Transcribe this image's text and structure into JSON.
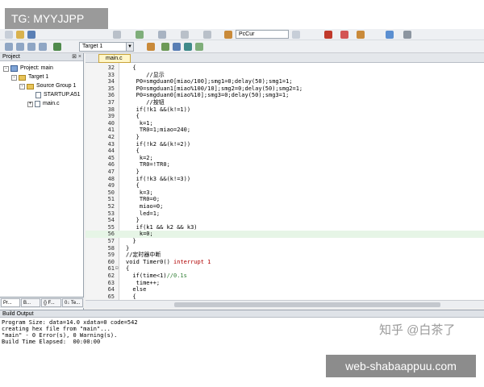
{
  "overlay": {
    "tag": "TG: MYYJJPP",
    "watermark": "知乎 @白茶了",
    "site": "web-shabaappuu.com"
  },
  "toolbar": {
    "target_select": "Target 1",
    "pc_combo": "PcCur"
  },
  "project_panel": {
    "title": "Project",
    "pin": "⊠ ×",
    "tree": [
      {
        "label": "Project: main",
        "icon": "project-icon",
        "depth": 0,
        "expander": "-"
      },
      {
        "label": "Target 1",
        "icon": "target-folder-icon",
        "depth": 1,
        "expander": "-"
      },
      {
        "label": "Source Group 1",
        "icon": "folder-icon",
        "depth": 2,
        "expander": "-"
      },
      {
        "label": "STARTUP.A51",
        "icon": "file-icon",
        "depth": 3,
        "expander": ""
      },
      {
        "label": "main.c",
        "icon": "file-icon",
        "depth": 3,
        "expander": "+"
      }
    ],
    "bottom_tabs": [
      "Pr...",
      "B...",
      "{} F...",
      "0↓ Te..."
    ]
  },
  "editor": {
    "tab": "main.c",
    "first_line": 32,
    "highlight_line": 56,
    "lines": [
      {
        "fold": "",
        "code": "  {"
      },
      {
        "fold": "",
        "code": "      //显示"
      },
      {
        "fold": "",
        "code": "   P0=smgduan0[miao/100];smg1=0;delay(50);smg1=1;"
      },
      {
        "fold": "",
        "code": "   P0=smgduan1[miao%100/10];smg2=0;delay(50);smg2=1;"
      },
      {
        "fold": "",
        "code": "   P0=smgduan0[miao%10];smg3=0;delay(50);smg3=1;"
      },
      {
        "fold": "",
        "code": "      //按钮"
      },
      {
        "fold": "",
        "code": "   if(!k1 &&(k!=1))"
      },
      {
        "fold": "",
        "code": "   {"
      },
      {
        "fold": "",
        "code": "    k=1;"
      },
      {
        "fold": "",
        "code": "    TR0=1;miao=240;"
      },
      {
        "fold": "",
        "code": "   }"
      },
      {
        "fold": "",
        "code": "   if(!k2 &&(k!=2))"
      },
      {
        "fold": "",
        "code": "   {"
      },
      {
        "fold": "",
        "code": "    k=2;"
      },
      {
        "fold": "",
        "code": "    TR0=!TR0;"
      },
      {
        "fold": "",
        "code": "   }"
      },
      {
        "fold": "",
        "code": "   if(!k3 &&(k!=3))"
      },
      {
        "fold": "",
        "code": "   {"
      },
      {
        "fold": "",
        "code": "    k=3;"
      },
      {
        "fold": "",
        "code": "    TR0=0;"
      },
      {
        "fold": "",
        "code": "    miao=0;"
      },
      {
        "fold": "",
        "code": "    led=1;"
      },
      {
        "fold": "",
        "code": "   }"
      },
      {
        "fold": "",
        "code": "   if(k1 && k2 && k3)"
      },
      {
        "fold": "",
        "code": "    k=0;"
      },
      {
        "fold": "",
        "code": "  }"
      },
      {
        "fold": "",
        "code": "}"
      },
      {
        "fold": "",
        "code": "//定时器中断"
      },
      {
        "fold": "",
        "code": "void Timer0() interrupt 1"
      },
      {
        "fold": "⊟",
        "code": "{"
      },
      {
        "fold": "",
        "code": "  if(time<1)//0.1s"
      },
      {
        "fold": "",
        "code": "   time++;"
      },
      {
        "fold": "",
        "code": "  else"
      },
      {
        "fold": "",
        "code": "  {"
      }
    ]
  },
  "build_output": {
    "title": "Build Output",
    "lines": [
      "Program Size: data=14.0 xdata=0 code=542",
      "creating hex file from \"main\"...",
      "\"main\" - 0 Error(s), 0 Warning(s).",
      "Build Time Elapsed:  00:00:00"
    ]
  },
  "colors": {
    "comment": "#2e7d32",
    "keyword": "#b00000",
    "highlight_line": "#e6f5e6"
  }
}
